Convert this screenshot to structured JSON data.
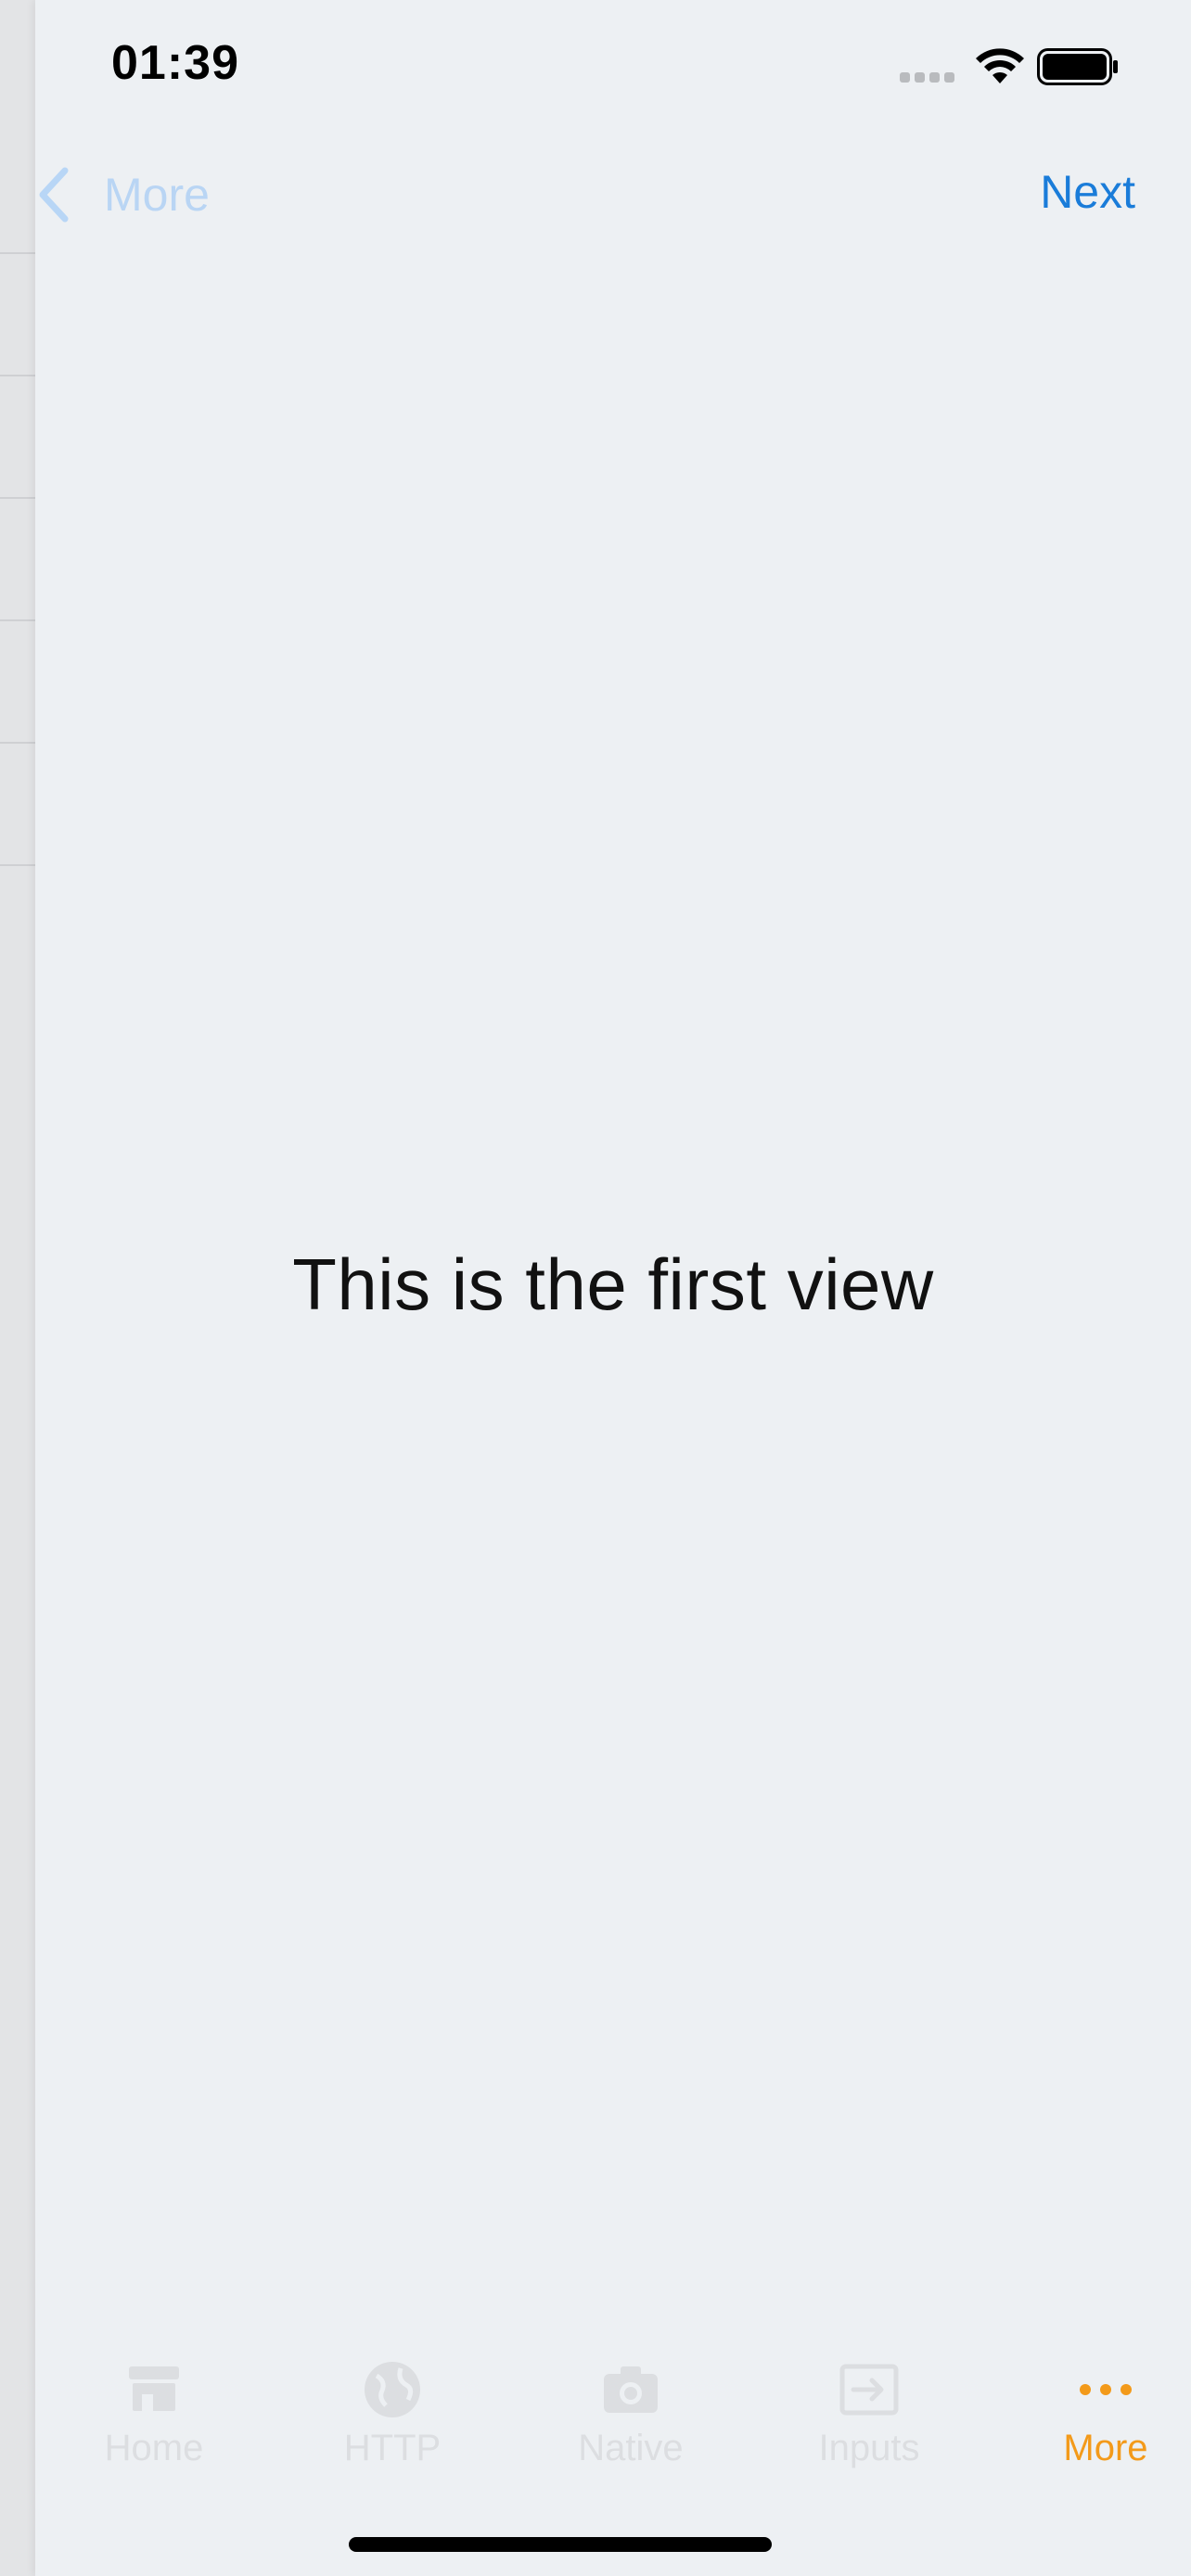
{
  "status_bar": {
    "time": "01:39"
  },
  "nav": {
    "back_label": "More",
    "next_label": "Next"
  },
  "content": {
    "text": "This is the first view"
  },
  "tabs": [
    {
      "label": "Home",
      "icon": "store-icon",
      "active": false
    },
    {
      "label": "HTTP",
      "icon": "globe-icon",
      "active": false
    },
    {
      "label": "Native",
      "icon": "camera-icon",
      "active": false
    },
    {
      "label": "Inputs",
      "icon": "input-icon",
      "active": false
    },
    {
      "label": "More",
      "icon": "more-dots-icon",
      "active": true
    }
  ],
  "colors": {
    "accent": "#f39a1a",
    "link": "#1a7cd9",
    "background": "#edf0f3"
  }
}
